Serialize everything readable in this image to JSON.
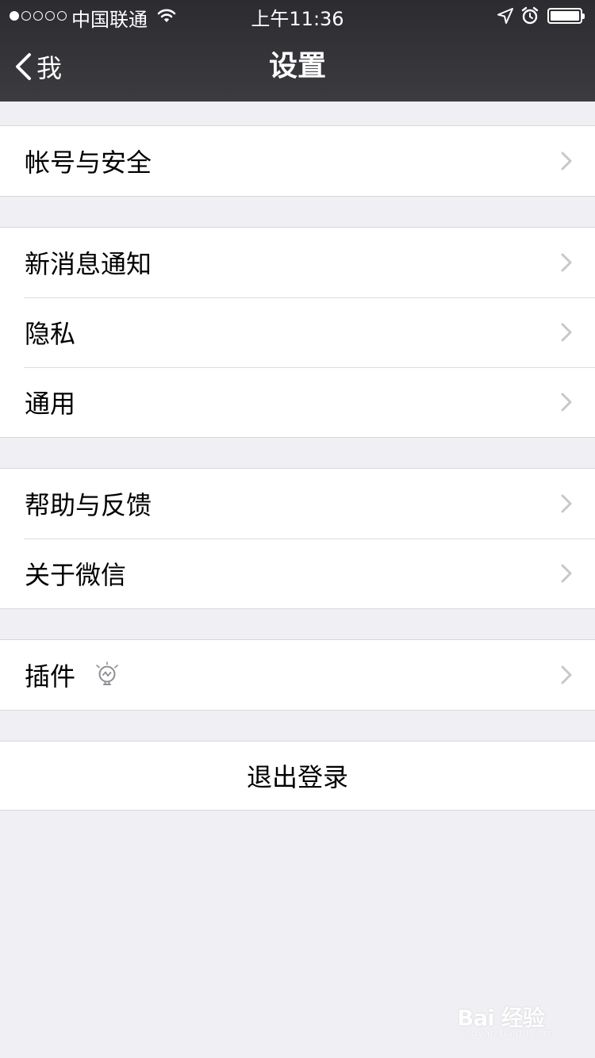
{
  "status_bar": {
    "signal_total": 5,
    "signal_filled": 1,
    "carrier": "中国联通",
    "time": "上午11:36",
    "icons": [
      "wifi-icon",
      "location-arrow-icon",
      "alarm-icon",
      "battery-icon"
    ],
    "battery_level": 1.0
  },
  "nav": {
    "back_label": "我",
    "title": "设置"
  },
  "groups": [
    {
      "items": [
        {
          "label": "帐号与安全"
        }
      ]
    },
    {
      "items": [
        {
          "label": "新消息通知"
        },
        {
          "label": "隐私"
        },
        {
          "label": "通用"
        }
      ]
    },
    {
      "items": [
        {
          "label": "帮助与反馈"
        },
        {
          "label": "关于微信"
        }
      ]
    },
    {
      "items": [
        {
          "label": "插件",
          "icon": "lightbulb-icon"
        }
      ]
    }
  ],
  "logout": {
    "label": "退出登录"
  },
  "watermark": {
    "main": "Bai 经验",
    "sub": "jingyan.baidu.com"
  },
  "colors": {
    "background": "#efeff4",
    "nav_bar": "#37373c",
    "chevron": "#c7c7cc"
  }
}
